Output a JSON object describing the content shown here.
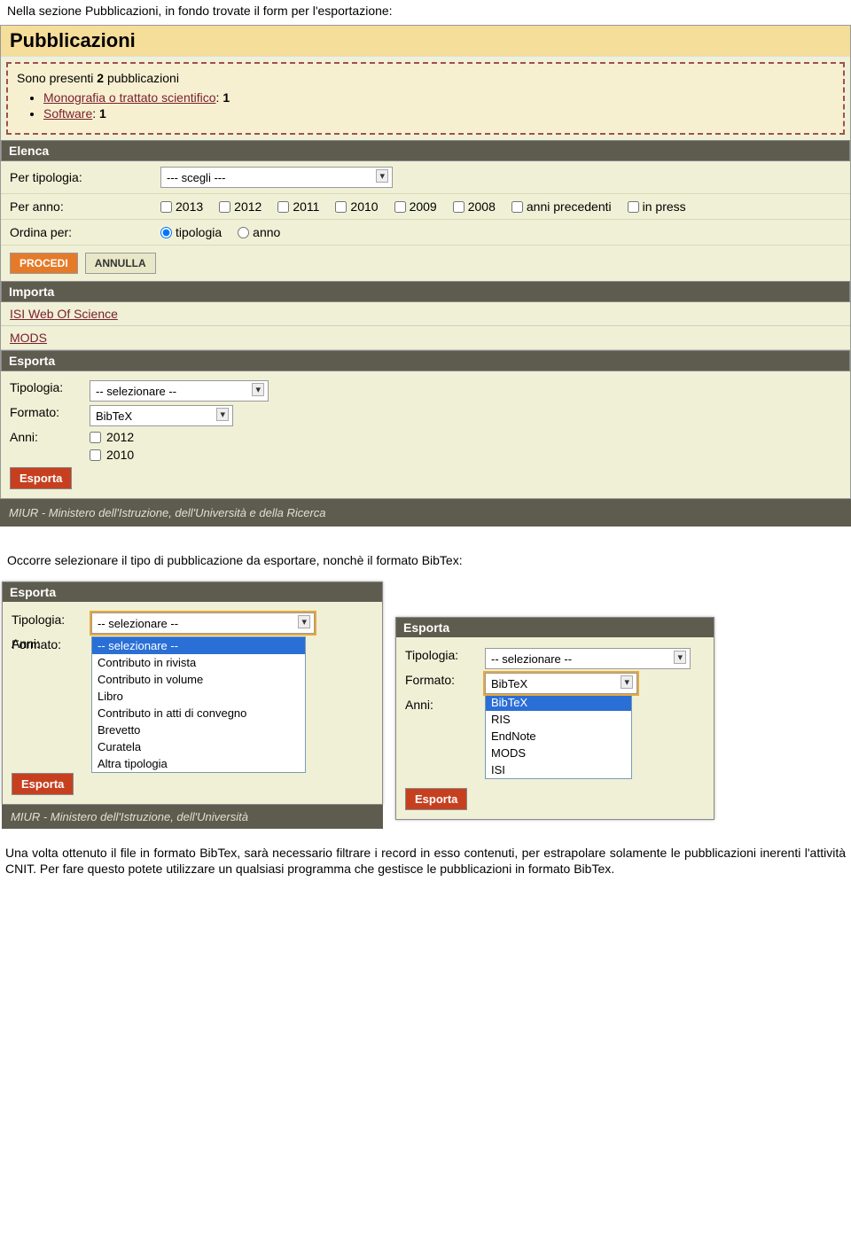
{
  "intro1": "Nella sezione Pubblicazioni, in fondo trovate il form per l'esportazione:",
  "pubblicazioni": {
    "header": "Pubblicazioni",
    "summary_prefix": "Sono presenti ",
    "summary_count": "2",
    "summary_suffix": " pubblicazioni",
    "items": [
      {
        "label": "Monografia o trattato scientifico",
        "count": "1"
      },
      {
        "label": "Software",
        "count": "1"
      }
    ]
  },
  "elenca": {
    "header": "Elenca",
    "per_tipologia_label": "Per tipologia:",
    "per_tipologia_value": "--- scegli ---",
    "per_anno_label": "Per anno:",
    "years": [
      "2013",
      "2012",
      "2011",
      "2010",
      "2009",
      "2008",
      "anni precedenti",
      "in press"
    ],
    "ordina_label": "Ordina per:",
    "ordina_opts": [
      "tipologia",
      "anno"
    ],
    "procedi": "PROCEDI",
    "annulla": "ANNULLA"
  },
  "importa": {
    "header": "Importa",
    "links": [
      "ISI Web Of Science",
      "MODS"
    ]
  },
  "esporta": {
    "header": "Esporta",
    "tipologia_label": "Tipologia:",
    "tipologia_value": "-- selezionare --",
    "formato_label": "Formato:",
    "formato_value": "BibTeX",
    "anni_label": "Anni:",
    "anni": [
      "2012",
      "2010"
    ],
    "button": "Esporta"
  },
  "footer": "MIUR - Ministero dell'Istruzione, dell'Università e della Ricerca",
  "intro2": "Occorre selezionare il tipo di pubblicazione da esportare, nonchè il formato BibTex:",
  "mini_left": {
    "header": "Esporta",
    "tipologia_label": "Tipologia:",
    "tipologia_value": "-- selezionare --",
    "formato_label": "Formato:",
    "anni_label": "Anni:",
    "button": "Esporta",
    "options": [
      "-- selezionare --",
      "Contributo in rivista",
      "Contributo in volume",
      "Libro",
      "Contributo in atti di convegno",
      "Brevetto",
      "Curatela",
      "Altra tipologia"
    ],
    "footer_partial": "MIUR - Ministero dell'Istruzione, dell'Università"
  },
  "mini_right": {
    "header": "Esporta",
    "tipologia_label": "Tipologia:",
    "tipologia_value": "-- selezionare --",
    "formato_label": "Formato:",
    "formato_value": "BibTeX",
    "anni_label": "Anni:",
    "button": "Esporta",
    "options": [
      "BibTeX",
      "RIS",
      "EndNote",
      "MODS",
      "ISI"
    ]
  },
  "final": "Una volta ottenuto il file in formato BibTex, sarà necessario filtrare i record in esso contenuti, per estrapolare solamente le pubblicazioni inerenti l'attività CNIT. Per fare questo potete utilizzare un qualsiasi programma che gestisce le pubblicazioni in formato BibTex."
}
